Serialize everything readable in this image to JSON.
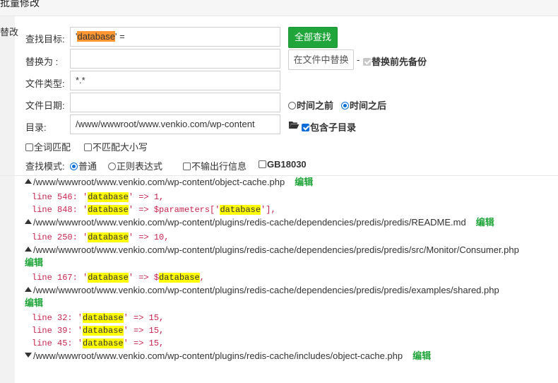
{
  "window": {
    "title": "批量修改"
  },
  "sidebar": {
    "tab_label": "替改"
  },
  "form": {
    "search_label": "查找目标:",
    "search_value_pre": "'",
    "search_value_hl": "database",
    "search_value_post": "' =",
    "search_all_button": "全部查找",
    "replace_label": "替换为 :",
    "replace_value": "",
    "replace_in_file_button": "在文件中替换",
    "dash": "-",
    "backup_label": "替换前先备份",
    "filetype_label": "文件类型:",
    "filetype_value": "*.*",
    "filedate_label": "文件日期:",
    "filedate_value": "",
    "before_label": "时间之前",
    "after_label": "时间之后",
    "dir_label": "目录:",
    "dir_value": "/www/wwwroot/www.venkio.com/wp-content",
    "include_subdir_label": "包含子目录",
    "whole_word_label": "全词匹配",
    "ignore_case_label": "不匹配大小写",
    "mode_label": "查找模式:",
    "mode_normal": "普通",
    "mode_regex": "正则表达式",
    "no_output_line_label": "不输出行信息",
    "gb18030_label": "GB18030"
  },
  "results": {
    "edit_label": "编辑",
    "files": [
      {
        "path": "/www/wwwroot/www.venkio.com/wp-content/object-cache.php",
        "expanded": true,
        "lines": [
          {
            "prefix": "line 546: '",
            "hl": "database",
            "suffix": "' => 1,",
            "hl2": "",
            "suffix2": ""
          },
          {
            "prefix": "line 848: '",
            "hl": "database",
            "suffix": "' => $parameters['",
            "hl2": "database",
            "suffix2": "'],"
          }
        ]
      },
      {
        "path": "/www/wwwroot/www.venkio.com/wp-content/plugins/redis-cache/dependencies/predis/predis/README.md",
        "expanded": true,
        "lines": [
          {
            "prefix": "line 250: '",
            "hl": "database",
            "suffix": "' => 10,",
            "hl2": "",
            "suffix2": ""
          }
        ]
      },
      {
        "path": "/www/wwwroot/www.venkio.com/wp-content/plugins/redis-cache/dependencies/predis/predis/src/Monitor/Consumer.php",
        "expanded": true,
        "lines": [
          {
            "prefix": "line 167: '",
            "hl": "database",
            "suffix": "' => $",
            "hl2": "database",
            "suffix2": ","
          }
        ]
      },
      {
        "path": "/www/wwwroot/www.venkio.com/wp-content/plugins/redis-cache/dependencies/predis/predis/examples/shared.php",
        "expanded": true,
        "lines": [
          {
            "prefix": "line 32: '",
            "hl": "database",
            "suffix": "' => 15,",
            "hl2": "",
            "suffix2": ""
          },
          {
            "prefix": "line 39: '",
            "hl": "database",
            "suffix": "' => 15,",
            "hl2": "",
            "suffix2": ""
          },
          {
            "prefix": "line 45: '",
            "hl": "database",
            "suffix": "' => 15,",
            "hl2": "",
            "suffix2": ""
          }
        ]
      },
      {
        "path": "/www/wwwroot/www.venkio.com/wp-content/plugins/redis-cache/includes/object-cache.php",
        "expanded": false,
        "lines": []
      }
    ]
  }
}
